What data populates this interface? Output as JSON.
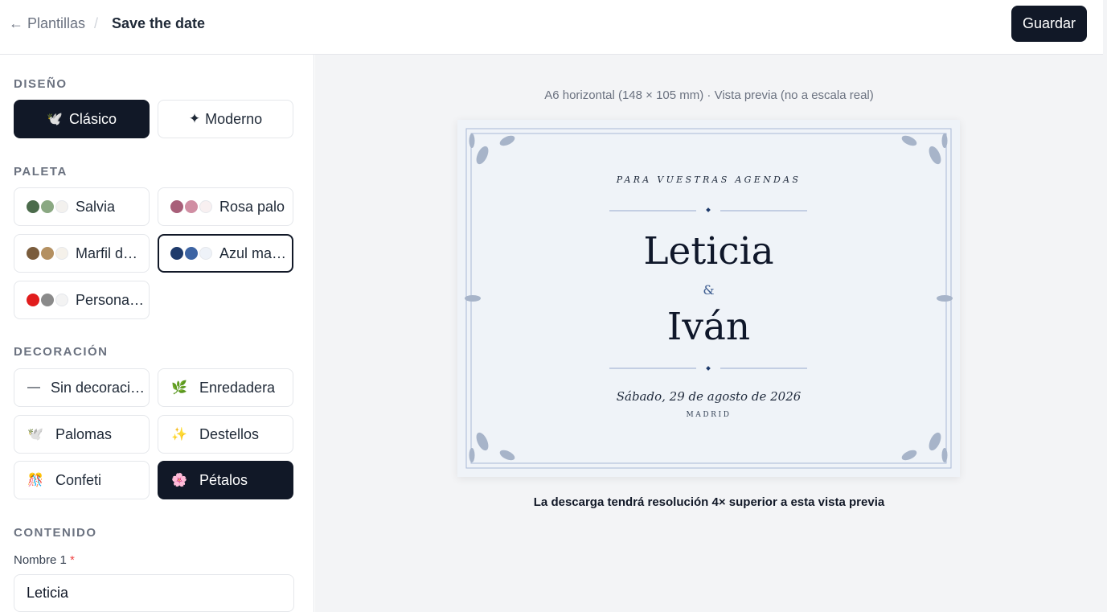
{
  "header": {
    "back_label": "← Plantillas",
    "separator": "/",
    "current": "Save the date",
    "save_label": "Guardar"
  },
  "sidebar": {
    "design": {
      "label": "DISEÑO",
      "options": [
        {
          "icon": "🕊️",
          "label": "Clásico",
          "selected": true
        },
        {
          "icon": "✦",
          "label": "Moderno",
          "selected": false
        }
      ]
    },
    "palette": {
      "label": "PALETA",
      "options": [
        {
          "label": "Salvia",
          "colors": [
            "#4b6b4b",
            "#8aa882",
            "#f3f1ee"
          ]
        },
        {
          "label": "Rosa palo",
          "colors": [
            "#a85f79",
            "#d08ea3",
            "#f8f0f1"
          ]
        },
        {
          "label": "Marfil d…",
          "colors": [
            "#7a5c3c",
            "#b49061",
            "#f5f1ea"
          ]
        },
        {
          "label": "Azul ma…",
          "colors": [
            "#1e3a6b",
            "#3d64a3",
            "#eef2f8"
          ],
          "selected": true
        },
        {
          "label": "Persona…",
          "colors": [
            "#e11d1d",
            "#8a8a8a",
            "#f3f3f3"
          ]
        }
      ]
    },
    "decoration": {
      "label": "DECORACIÓN",
      "options": [
        {
          "icon": "—",
          "label": "Sin decoraci…",
          "selected": false
        },
        {
          "icon": "🌿",
          "label": "Enredadera",
          "selected": false
        },
        {
          "icon": "🕊️",
          "label": "Palomas",
          "selected": false
        },
        {
          "icon": "✨",
          "label": "Destellos",
          "selected": false
        },
        {
          "icon": "🎊",
          "label": "Confeti",
          "selected": false
        },
        {
          "icon": "🌸",
          "label": "Pétalos",
          "selected": true
        }
      ]
    },
    "content": {
      "label": "CONTENIDO",
      "name1_label": "Nombre 1",
      "required_mark": "*",
      "name1_value": "Leticia"
    }
  },
  "preview": {
    "caption": "A6 horizontal (148 × 105 mm) · Vista previa (no a escala real)",
    "card": {
      "eyebrow": "PARA VUESTRAS AGENDAS",
      "name1": "Leticia",
      "ampersand": "&",
      "name2": "Iván",
      "date": "Sábado, 29 de agosto de 2026",
      "place": "MADRID"
    },
    "note": "La descarga tendrá resolución 4× superior a esta vista previa"
  },
  "colors": {
    "primary": "#111827",
    "accent_blue": "#3d64a3",
    "card_bg": "#eff3f8",
    "required": "#ef4444"
  }
}
